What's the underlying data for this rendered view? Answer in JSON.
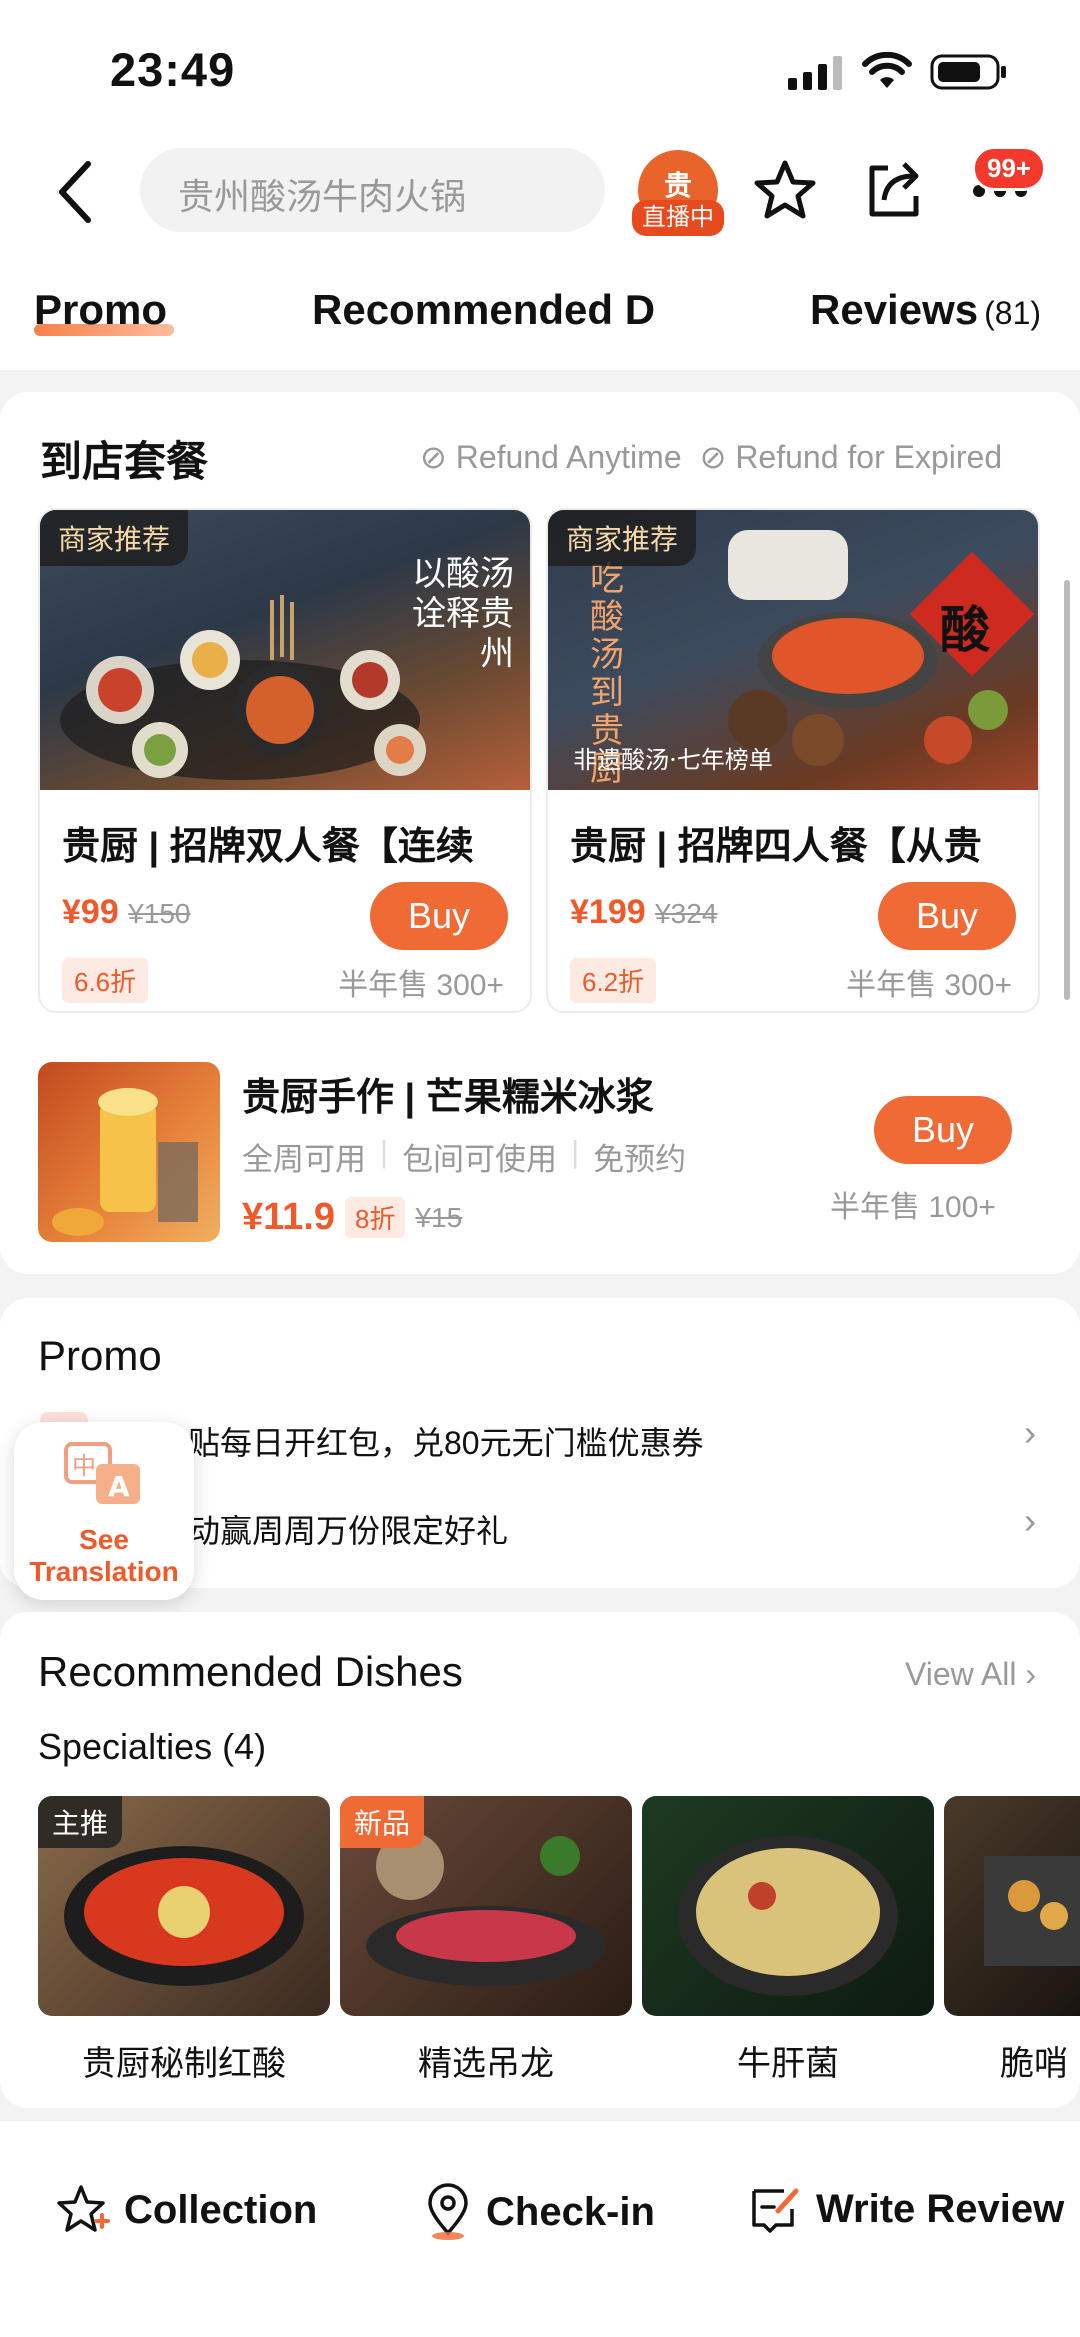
{
  "status_bar": {
    "time": "23:49"
  },
  "header": {
    "search_text": "贵州酸汤牛肉火锅",
    "live_badge": "直播中",
    "live_logo": "贵",
    "notification_badge": "99+"
  },
  "tabs": [
    {
      "label": "Promo"
    },
    {
      "label": "Recommended D"
    },
    {
      "label": "Reviews",
      "count": "(81)"
    }
  ],
  "dine_in": {
    "title": "到店套餐",
    "tags": [
      "Refund Anytime",
      "Refund for Expired"
    ],
    "deals": [
      {
        "chip": "商家推荐",
        "image_text": "以酸汤诠释贵州",
        "name": "贵厨 | 招牌双人餐【连续",
        "price": "¥99",
        "original": "¥150",
        "discount": "6.6折",
        "sold": "半年售 300+",
        "buy": "Buy"
      },
      {
        "chip": "商家推荐",
        "image_text": "吃酸汤到贵厨",
        "image_subtext": "非遗酸汤·七年榜单",
        "image_char": "酸",
        "name": "贵厨 | 招牌四人餐【从贵",
        "price": "¥199",
        "original": "¥324",
        "discount": "6.2折",
        "sold": "半年售 300+",
        "buy": "Buy"
      }
    ],
    "single": {
      "name": "贵厨手作 | 芒果糯米冰浆",
      "features": [
        "全周可用",
        "包间可使用",
        "免预约"
      ],
      "price": "¥11.9",
      "discount": "8折",
      "original": "¥15",
      "sold": "半年售 100+",
      "buy": "Buy"
    }
  },
  "promo": {
    "title": "Promo",
    "items": [
      {
        "text": "补贴每日开红包，兑80元无门槛优惠券"
      },
      {
        "text": "活动赢周周万份限定好礼"
      }
    ]
  },
  "translation": {
    "line1": "See",
    "line2": "Translation"
  },
  "dishes": {
    "title": "Recommended Dishes",
    "view_all": "View All",
    "subtitle": "Specialties (4)",
    "items": [
      {
        "chip": "主推",
        "name": "贵厨秘制红酸"
      },
      {
        "chip": "新品",
        "name": "精选吊龙"
      },
      {
        "chip": "",
        "name": "牛肝菌"
      },
      {
        "chip": "",
        "name": "脆哨"
      }
    ]
  },
  "bottom_bar": {
    "collection": "Collection",
    "checkin": "Check-in",
    "write_review": "Write Review"
  },
  "colors": {
    "accent": "#f06a35",
    "price": "#f0592a"
  }
}
